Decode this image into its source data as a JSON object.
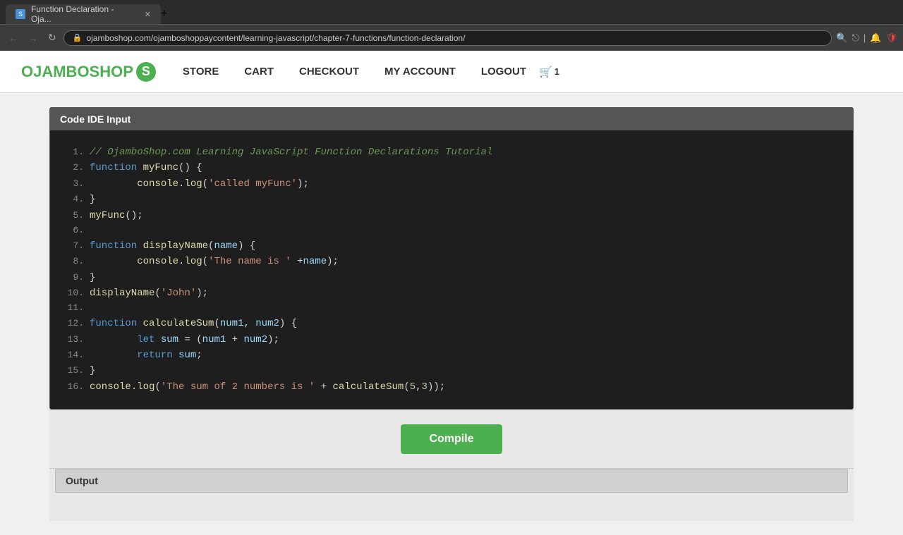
{
  "browser": {
    "tab_title": "Function Declaration - Oja...",
    "tab_favicon": "S",
    "url": "ojamboshop.com/ojamboshoppaycontent/learning-javascript/chapter-7-functions/function-declaration/",
    "new_tab_label": "+"
  },
  "nav": {
    "brand": "OJAMBOSHOP",
    "brand_logo": "S",
    "links": [
      {
        "label": "STORE",
        "active": false
      },
      {
        "label": "CART",
        "active": false
      },
      {
        "label": "CHECKOUT",
        "active": false
      },
      {
        "label": "MY ACCOUNT",
        "active": false
      },
      {
        "label": "LOGOUT",
        "active": false
      }
    ],
    "cart_icon": "🛒",
    "cart_count": "1"
  },
  "ide": {
    "header": "Code IDE Input",
    "compile_button": "Compile",
    "output_header": "Output"
  },
  "code": {
    "lines": [
      {
        "num": "1.",
        "content": "comment",
        "text": "// OjamboShop.com Learning JavaScript Function Declarations Tutorial"
      },
      {
        "num": "2.",
        "content": "mixed"
      },
      {
        "num": "3.",
        "content": "mixed"
      },
      {
        "num": "4.",
        "content": "plain",
        "text": "}"
      },
      {
        "num": "5.",
        "content": "mixed"
      },
      {
        "num": "6.",
        "content": "plain",
        "text": ""
      },
      {
        "num": "7.",
        "content": "mixed"
      },
      {
        "num": "8.",
        "content": "mixed"
      },
      {
        "num": "9.",
        "content": "plain",
        "text": "}"
      },
      {
        "num": "10.",
        "content": "mixed"
      },
      {
        "num": "11.",
        "content": "plain",
        "text": ""
      },
      {
        "num": "12.",
        "content": "mixed"
      },
      {
        "num": "13.",
        "content": "mixed"
      },
      {
        "num": "14.",
        "content": "mixed"
      },
      {
        "num": "15.",
        "content": "plain",
        "text": "}"
      },
      {
        "num": "16.",
        "content": "mixed"
      }
    ]
  }
}
